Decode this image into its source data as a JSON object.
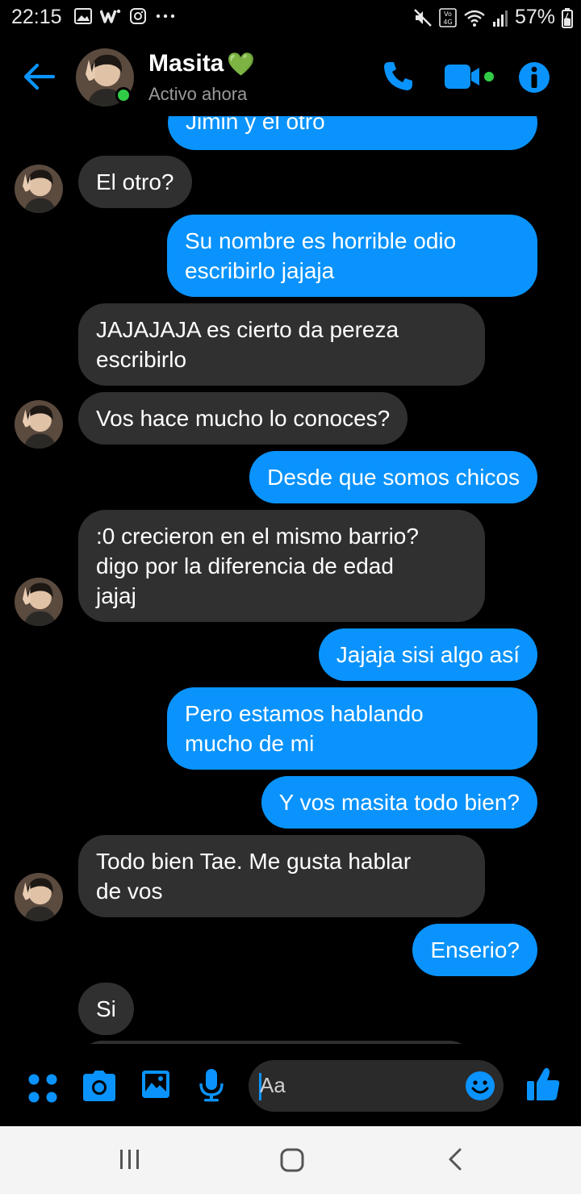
{
  "status_bar": {
    "time": "22:15",
    "battery": "57%",
    "icons": [
      "image-icon",
      "w-icon",
      "instagram-icon",
      "more-icon",
      "mute-icon",
      "volte-icon",
      "wifi-icon",
      "signal-icon",
      "battery-icon"
    ]
  },
  "header": {
    "name": "Masita",
    "name_emoji": "💚",
    "status": "Activo ahora",
    "accent": "#0a93fc",
    "online_color": "#31cc46"
  },
  "messages": [
    {
      "from": "me",
      "text": "Jimin y el otro"
    },
    {
      "from": "them",
      "text": "El otro?"
    },
    {
      "from": "me",
      "text": "Su nombre es horrible odio\nescribirlo jajaja"
    },
    {
      "from": "them",
      "text": "JAJAJAJA es cierto da pereza\nescribirlo"
    },
    {
      "from": "them",
      "text": "Vos hace mucho lo conoces?"
    },
    {
      "from": "me",
      "text": "Desde que somos chicos"
    },
    {
      "from": "them",
      "text": ":0 crecieron en el mismo barrio?\ndigo por la diferencia de edad\njajaj"
    },
    {
      "from": "me",
      "text": "Jajaja sisi algo así"
    },
    {
      "from": "me",
      "text": "Pero estamos hablando\nmucho de mi"
    },
    {
      "from": "me",
      "text": "Y vos masita todo bien?"
    },
    {
      "from": "them",
      "text": "Todo bien Tae. Me gusta hablar\nde vos"
    },
    {
      "from": "me",
      "text": "Enserio?"
    },
    {
      "from": "them",
      "text": "Si"
    }
  ],
  "composer": {
    "placeholder": "Aa"
  },
  "colors": {
    "my_bubble": "#0a93fc",
    "their_bubble": "#303030",
    "background": "#000000",
    "nav_bar": "#f4f4f4"
  }
}
